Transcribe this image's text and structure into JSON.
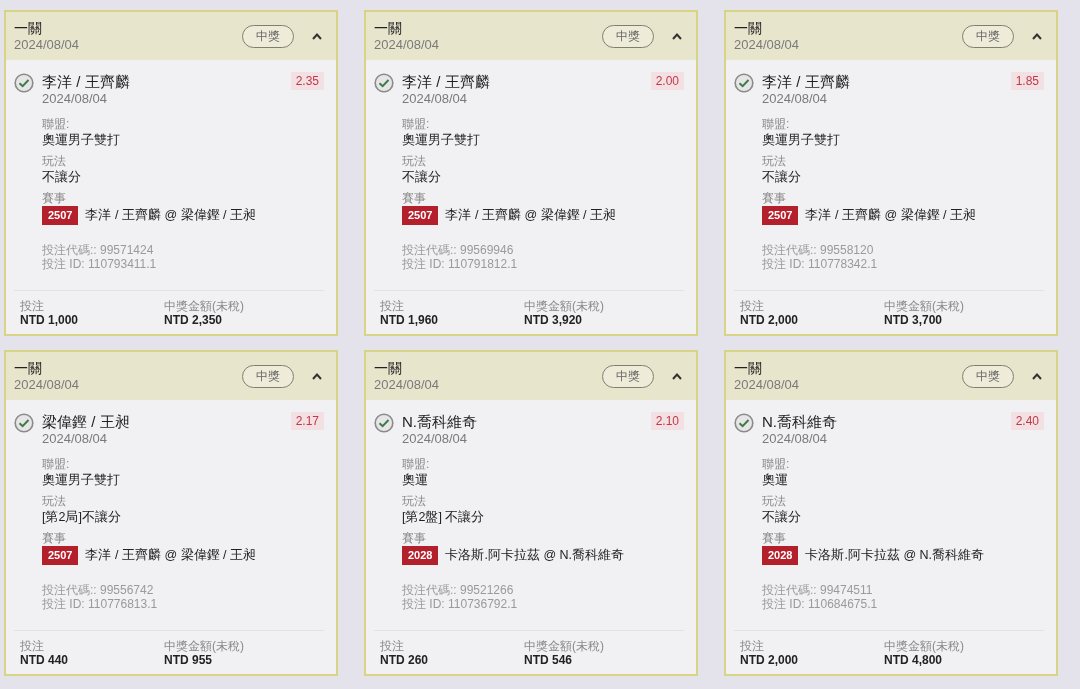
{
  "cards": [
    {
      "title": "一關",
      "date": "2024/08/04",
      "status": "中獎",
      "expanded": true,
      "selection": {
        "name": "李洋 / 王齊麟",
        "date": "2024/08/04",
        "odds": "2.35"
      },
      "fields": [
        {
          "kind": "text",
          "label": "聯盟:",
          "value": "奧運男子雙打"
        },
        {
          "kind": "text",
          "label": "玩法",
          "value": "不讓分"
        },
        {
          "kind": "event",
          "label": "賽事",
          "code": "2507",
          "value": "李洋 / 王齊麟 @ 梁偉鏗 / 王昶"
        }
      ],
      "bet_code": "投注代碼:: 99571424",
      "bet_id": "投注 ID: 110793411.1",
      "stake_label": "投注",
      "stake": "NTD 1,000",
      "payout_label": "中獎金額(未稅)",
      "payout": "NTD 2,350"
    },
    {
      "title": "一關",
      "date": "2024/08/04",
      "status": "中獎",
      "expanded": true,
      "selection": {
        "name": "李洋 / 王齊麟",
        "date": "2024/08/04",
        "odds": "2.00"
      },
      "fields": [
        {
          "kind": "text",
          "label": "聯盟:",
          "value": "奧運男子雙打"
        },
        {
          "kind": "text",
          "label": "玩法",
          "value": "不讓分"
        },
        {
          "kind": "event",
          "label": "賽事",
          "code": "2507",
          "value": "李洋 / 王齊麟 @ 梁偉鏗 / 王昶"
        }
      ],
      "bet_code": "投注代碼:: 99569946",
      "bet_id": "投注 ID: 110791812.1",
      "stake_label": "投注",
      "stake": "NTD 1,960",
      "payout_label": "中獎金額(未稅)",
      "payout": "NTD 3,920"
    },
    {
      "title": "一關",
      "date": "2024/08/04",
      "status": "中獎",
      "expanded": true,
      "selection": {
        "name": "李洋 / 王齊麟",
        "date": "2024/08/04",
        "odds": "1.85"
      },
      "fields": [
        {
          "kind": "text",
          "label": "聯盟:",
          "value": "奧運男子雙打"
        },
        {
          "kind": "text",
          "label": "玩法",
          "value": "不讓分"
        },
        {
          "kind": "event",
          "label": "賽事",
          "code": "2507",
          "value": "李洋 / 王齊麟 @ 梁偉鏗 / 王昶"
        }
      ],
      "bet_code": "投注代碼:: 99558120",
      "bet_id": "投注 ID: 110778342.1",
      "stake_label": "投注",
      "stake": "NTD 2,000",
      "payout_label": "中獎金額(未稅)",
      "payout": "NTD 3,700"
    },
    {
      "title": "一關",
      "date": "2024/08/04",
      "status": "中獎",
      "expanded": true,
      "selection": {
        "name": "梁偉鏗 / 王昶",
        "date": "2024/08/04",
        "odds": "2.17"
      },
      "fields": [
        {
          "kind": "text",
          "label": "聯盟:",
          "value": "奧運男子雙打"
        },
        {
          "kind": "text",
          "label": "玩法",
          "value": "[第2局]不讓分"
        },
        {
          "kind": "event",
          "label": "賽事",
          "code": "2507",
          "value": "李洋 / 王齊麟 @ 梁偉鏗 / 王昶"
        }
      ],
      "bet_code": "投注代碼:: 99556742",
      "bet_id": "投注 ID: 110776813.1",
      "stake_label": "投注",
      "stake": "NTD 440",
      "payout_label": "中獎金額(未稅)",
      "payout": "NTD 955"
    },
    {
      "title": "一關",
      "date": "2024/08/04",
      "status": "中獎",
      "expanded": true,
      "selection": {
        "name": "N.喬科維奇",
        "date": "2024/08/04",
        "odds": "2.10"
      },
      "fields": [
        {
          "kind": "text",
          "label": "聯盟:",
          "value": "奧運"
        },
        {
          "kind": "text",
          "label": "玩法",
          "value": "[第2盤] 不讓分"
        },
        {
          "kind": "event",
          "label": "賽事",
          "code": "2028",
          "value": "卡洛斯.阿卡拉茲 @ N.喬科維奇"
        }
      ],
      "bet_code": "投注代碼:: 99521266",
      "bet_id": "投注 ID: 110736792.1",
      "stake_label": "投注",
      "stake": "NTD 260",
      "payout_label": "中獎金額(未稅)",
      "payout": "NTD 546"
    },
    {
      "title": "一關",
      "date": "2024/08/04",
      "status": "中獎",
      "expanded": true,
      "selection": {
        "name": "N.喬科維奇",
        "date": "2024/08/04",
        "odds": "2.40"
      },
      "fields": [
        {
          "kind": "text",
          "label": "聯盟:",
          "value": "奧運"
        },
        {
          "kind": "text",
          "label": "玩法",
          "value": "不讓分"
        },
        {
          "kind": "event",
          "label": "賽事",
          "code": "2028",
          "value": "卡洛斯.阿卡拉茲 @ N.喬科維奇"
        }
      ],
      "bet_code": "投注代碼:: 99474511",
      "bet_id": "投注 ID: 110684675.1",
      "stake_label": "投注",
      "stake": "NTD 2,000",
      "payout_label": "中獎金額(未稅)",
      "payout": "NTD 4,800"
    }
  ]
}
